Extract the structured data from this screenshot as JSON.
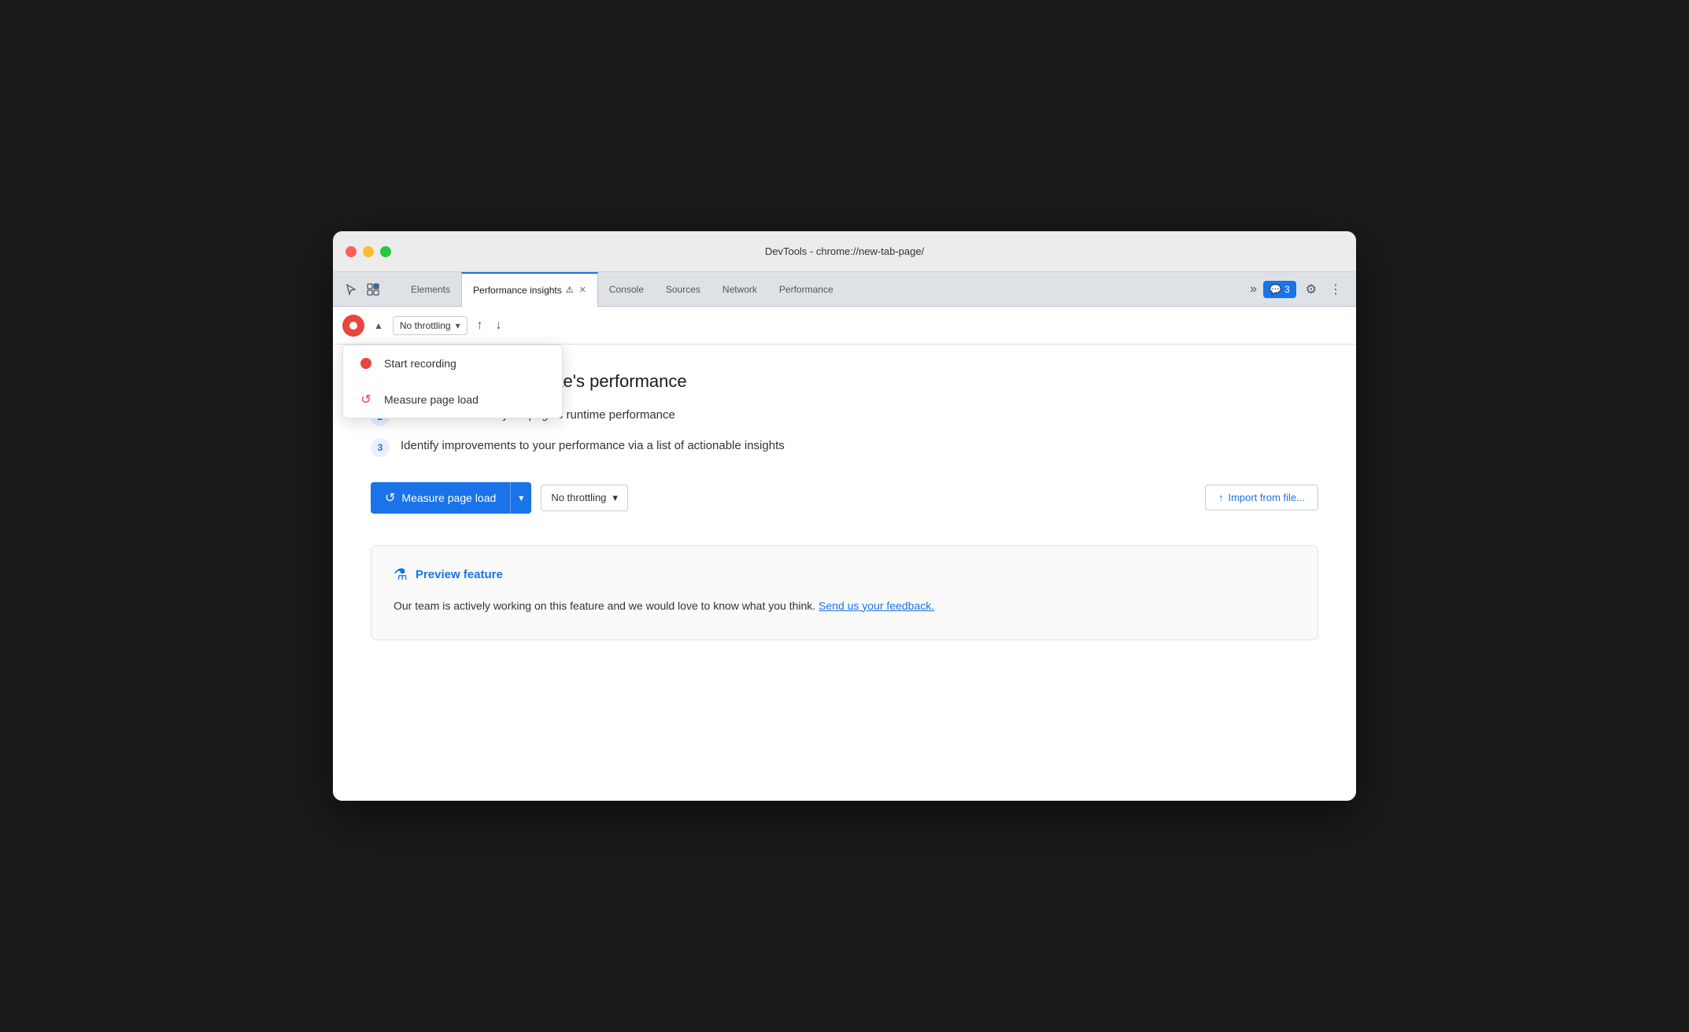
{
  "window": {
    "title": "DevTools - chrome://new-tab-page/"
  },
  "tabs": {
    "items": [
      {
        "label": "Elements",
        "active": false
      },
      {
        "label": "Performance insights",
        "active": true,
        "hasWarn": true,
        "closeable": true
      },
      {
        "label": "Console",
        "active": false
      },
      {
        "label": "Sources",
        "active": false
      },
      {
        "label": "Network",
        "active": false
      },
      {
        "label": "Performance",
        "active": false
      }
    ],
    "more_label": "»",
    "chat_count": "3",
    "gear_label": "⚙",
    "more_dots": "⋮"
  },
  "toolbar": {
    "throttle_label": "No throttling",
    "throttle_arrow": "▾",
    "upload_icon": "↑",
    "download_icon": "↓"
  },
  "dropdown": {
    "items": [
      {
        "id": "start-recording",
        "label": "Start recording",
        "icon": "dot"
      },
      {
        "id": "measure-page-load",
        "label": "Measure page load",
        "icon": "reload"
      }
    ]
  },
  "main": {
    "heading": "insights on your website's performance",
    "steps": [
      {
        "num": "2",
        "text": "Get an overview of your page's runtime performance"
      },
      {
        "num": "3",
        "text": "Identify improvements to your performance via a list of actionable insights"
      }
    ],
    "measure_btn": "Measure page load",
    "throttle_main": "No throttling",
    "import_btn": "Import from file...",
    "preview_title": "Preview feature",
    "preview_text": "Our team is actively working on this feature and we would love to know what you think.",
    "preview_link": "Send us your feedback."
  }
}
